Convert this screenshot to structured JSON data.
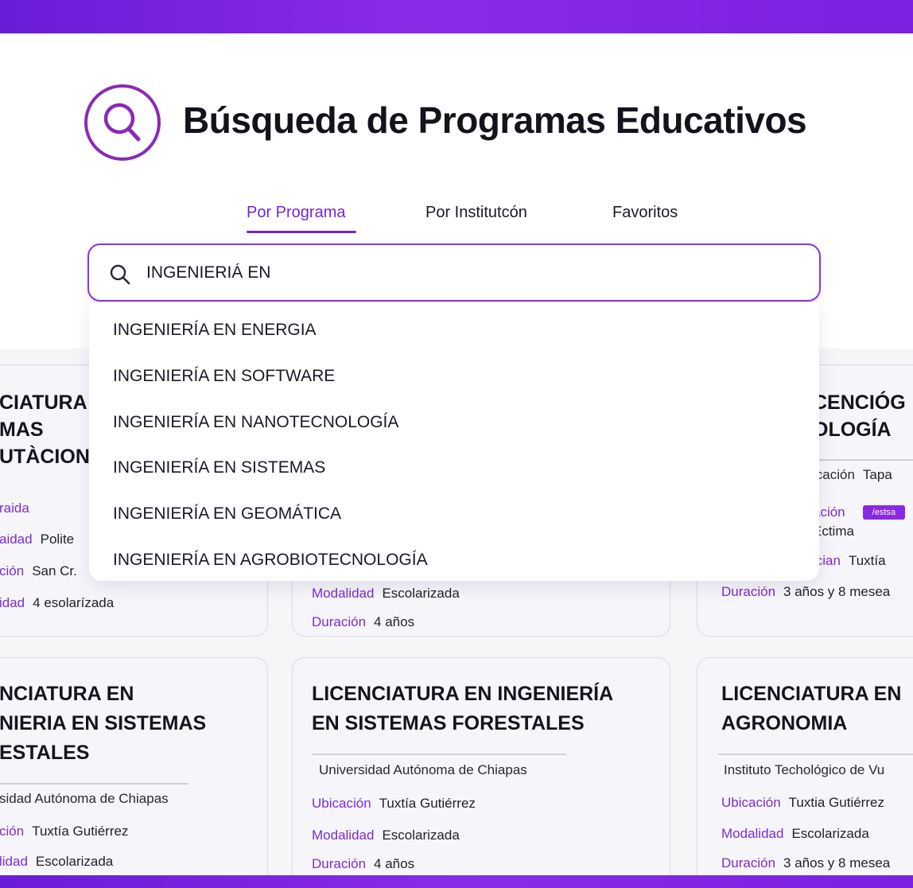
{
  "header": {
    "title": "Búsqueda de Programas Educativos",
    "logo_icon": "search-icon"
  },
  "tabs": [
    {
      "label": "Por Programa",
      "active": true
    },
    {
      "label": "Por Institutcón",
      "active": false
    },
    {
      "label": "Favoritos",
      "active": false
    }
  ],
  "search": {
    "value": "INGENIERIÁ EN",
    "icon": "search-icon"
  },
  "suggestions": [
    "INGENIERÍA EN ENERGIA",
    "INGENIERÍA EN SOFTWARE",
    "INGENIERÍA EN NANOTECNOLOGÍA",
    "INGENIERÍA EN SISTEMAS",
    "INGENIERÍA EN GEOMÁTICA",
    "INGENIERÍA EN AGROBIOTECNOLOGÍA"
  ],
  "cards_row1": {
    "left": {
      "title_lines": [
        "CIATURA",
        "MAS",
        "UTÀCION"
      ],
      "rows": [
        {
          "label": "raida",
          "value": ""
        },
        {
          "label": "aidad",
          "value": "Polite"
        },
        {
          "label": "ción",
          "value": "San Cr."
        },
        {
          "label": "idad",
          "value": "4 esolarízada"
        }
      ]
    },
    "middle": {
      "rows": [
        {
          "label": "Modalidad",
          "value": "Escolarizada"
        },
        {
          "label": "Duración",
          "value": "4 años"
        }
      ]
    },
    "right": {
      "title_lines": [
        "CENCIÓG",
        "OLOGÍA"
      ],
      "rows": [
        {
          "label": "icación",
          "value": "Tapa"
        },
        {
          "label": "ación",
          "value": "",
          "badge": "/estsa"
        },
        {
          "label": "",
          "value": "Ectima"
        },
        {
          "label": "ician",
          "value": "Tuxtía"
        },
        {
          "label": "Duración",
          "value": "3 años y 8 mesea"
        }
      ]
    }
  },
  "cards_row2": {
    "left": {
      "title_lines": [
        "NCIATURA EN",
        "NIERIA EN SISTEMAS",
        "ESTALES"
      ],
      "institution": "sidad Autónoma de Chiapas",
      "rows": [
        {
          "label": "ción",
          "value": "Tuxtía Gutiérrez"
        },
        {
          "label": "lidad",
          "value": "Escolarizada"
        }
      ]
    },
    "middle": {
      "title_lines": [
        "LICENCIATURA EN INGENIERÍA",
        "EN SISTEMAS FORESTALES"
      ],
      "institution": "Universidad Autónoma de Chiapas",
      "rows": [
        {
          "label": "Ubicación",
          "value": "Tuxtía Gutiérrez"
        },
        {
          "label": "Modalidad",
          "value": "Escolarizada"
        },
        {
          "label": "Duración",
          "value": "4 años"
        }
      ]
    },
    "right": {
      "title_lines": [
        "LICENCIATURA EN",
        "AGRONOMIA"
      ],
      "institution": "Instituto Techológico de Vu",
      "rows": [
        {
          "label": "Ubicación",
          "value": "Tuxtia Gutiérrez"
        },
        {
          "label": "Modalidad",
          "value": "Escolarizada"
        },
        {
          "label": "Duración",
          "value": "3 años y 8 mesea"
        }
      ]
    }
  },
  "colors": {
    "accent": "#7a24d0",
    "bar": "#8a2be8"
  }
}
